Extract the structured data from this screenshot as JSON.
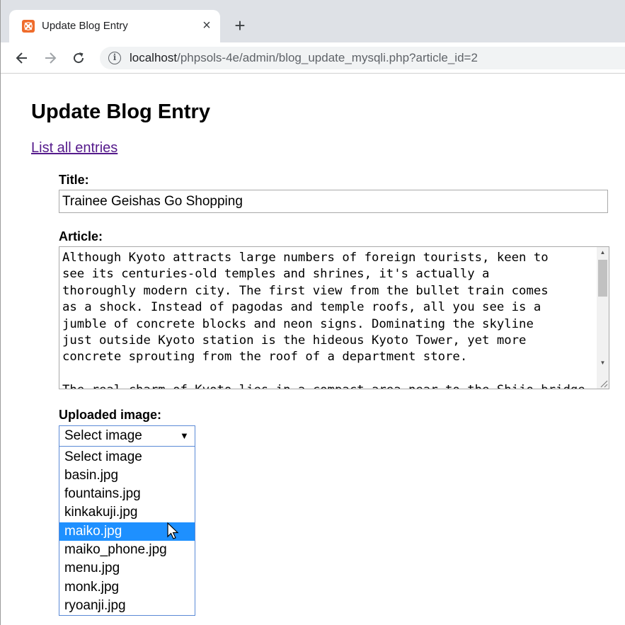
{
  "browser": {
    "tab_title": "Update Blog Entry",
    "tab_close": "×",
    "new_tab": "+",
    "url_host": "localhost",
    "url_rest": "/phpsols-4e/admin/blog_update_mysqli.php?article_id=2",
    "icons": {
      "favicon": "xampp-icon",
      "back": "back-arrow-icon",
      "forward": "forward-arrow-icon",
      "reload": "reload-icon",
      "info": "info-icon"
    }
  },
  "page": {
    "heading": "Update Blog Entry",
    "list_link": "List all entries",
    "title_label": "Title:",
    "title_value": "Trainee Geishas Go Shopping",
    "article_label": "Article:",
    "article_text": "Although Kyoto attracts large numbers of foreign tourists, keen to\nsee its centuries-old temples and shrines, it's actually a\nthoroughly modern city. The first view from the bullet train comes\nas a shock. Instead of pagodas and temple roofs, all you see is a\njumble of concrete blocks and neon signs. Dominating the skyline\njust outside Kyoto station is the hideous Kyoto Tower, yet more\nconcrete sprouting from the roof of a department store.\n\nThe real charm of Kyoto lies in a compact area near to the Shijo bridge",
    "image_label": "Uploaded image:",
    "image_select": {
      "selected": "Select image",
      "options": [
        "Select image",
        "basin.jpg",
        "fountains.jpg",
        "kinkakuji.jpg",
        "maiko.jpg",
        "maiko_phone.jpg",
        "menu.jpg",
        "monk.jpg",
        "ryoanji.jpg"
      ],
      "highlighted": "maiko.jpg"
    }
  },
  "colors": {
    "link": "#551a8b",
    "highlight": "#1e90ff",
    "focus_border": "#5b8ad6",
    "chrome_bg": "#dee1e6",
    "favicon": "#ef6b2b"
  }
}
